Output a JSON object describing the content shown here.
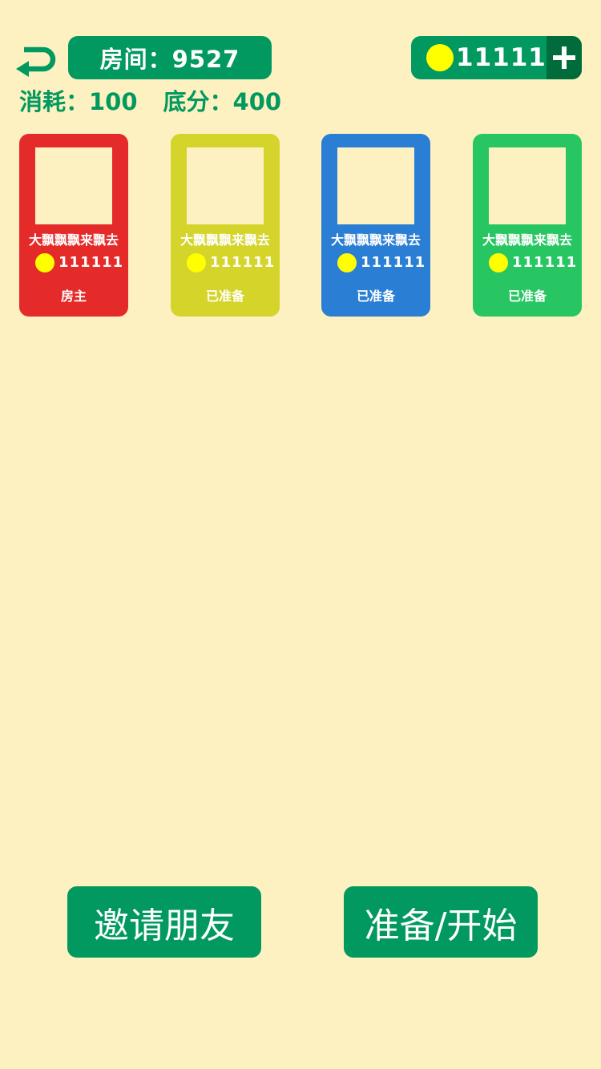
{
  "header": {
    "room_label": "房间：9527",
    "coin_amount": "111111",
    "cost_label": "消耗：100",
    "base_score_label": "底分：400"
  },
  "colors": {
    "primary_green": "#019960",
    "dark_green": "#006b3b",
    "background": "#fdf1c1",
    "coin_yellow": "#ffff00"
  },
  "players": [
    {
      "name": "大飘飘飘来飘去",
      "coins": "111111",
      "status": "房主",
      "color": "#e52a2a"
    },
    {
      "name": "大飘飘飘来飘去",
      "coins": "111111",
      "status": "已准备",
      "color": "#d4d42a"
    },
    {
      "name": "大飘飘飘来飘去",
      "coins": "111111",
      "status": "已准备",
      "color": "#2a7ed4"
    },
    {
      "name": "大飘飘飘来飘去",
      "coins": "111111",
      "status": "已准备",
      "color": "#28c662"
    }
  ],
  "actions": {
    "invite_label": "邀请朋友",
    "ready_start_label": "准备/开始"
  }
}
